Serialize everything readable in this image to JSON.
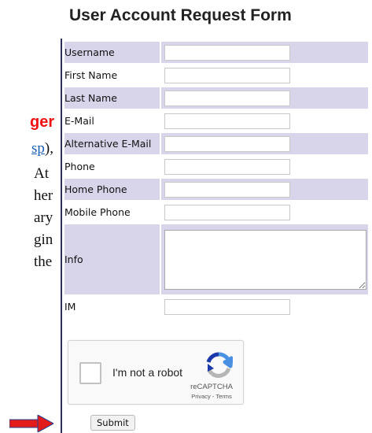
{
  "page": {
    "title": "User Account Request Form",
    "fragments": {
      "red": "ger",
      "link": "sp",
      "link_suffix": "),",
      "line3": "At",
      "line4": "her",
      "line5": "ary",
      "line6": "gin",
      "line7": "the"
    }
  },
  "form": {
    "fields": [
      {
        "label": "Username",
        "value": ""
      },
      {
        "label": "First Name",
        "value": ""
      },
      {
        "label": "Last Name",
        "value": ""
      },
      {
        "label": "E-Mail",
        "value": ""
      },
      {
        "label": "Alternative E-Mail",
        "value": ""
      },
      {
        "label": "Phone",
        "value": ""
      },
      {
        "label": "Home Phone",
        "value": ""
      },
      {
        "label": "Mobile Phone",
        "value": ""
      },
      {
        "label": "Info",
        "value": ""
      },
      {
        "label": "IM",
        "value": ""
      }
    ],
    "submit_label": "Submit"
  },
  "captcha": {
    "checkbox_label": "I'm not a robot",
    "brand": "reCAPTCHA",
    "privacy": "Privacy",
    "separator": " - ",
    "terms": "Terms"
  },
  "colors": {
    "row_shade": "#d8d4ea",
    "title_red": "#ee1111",
    "link_blue": "#1a5fb4",
    "arrow_red": "#e31b1b"
  },
  "icons": {
    "captcha_logo": "recaptcha-logo-icon",
    "pointer": "right-arrow-icon"
  }
}
